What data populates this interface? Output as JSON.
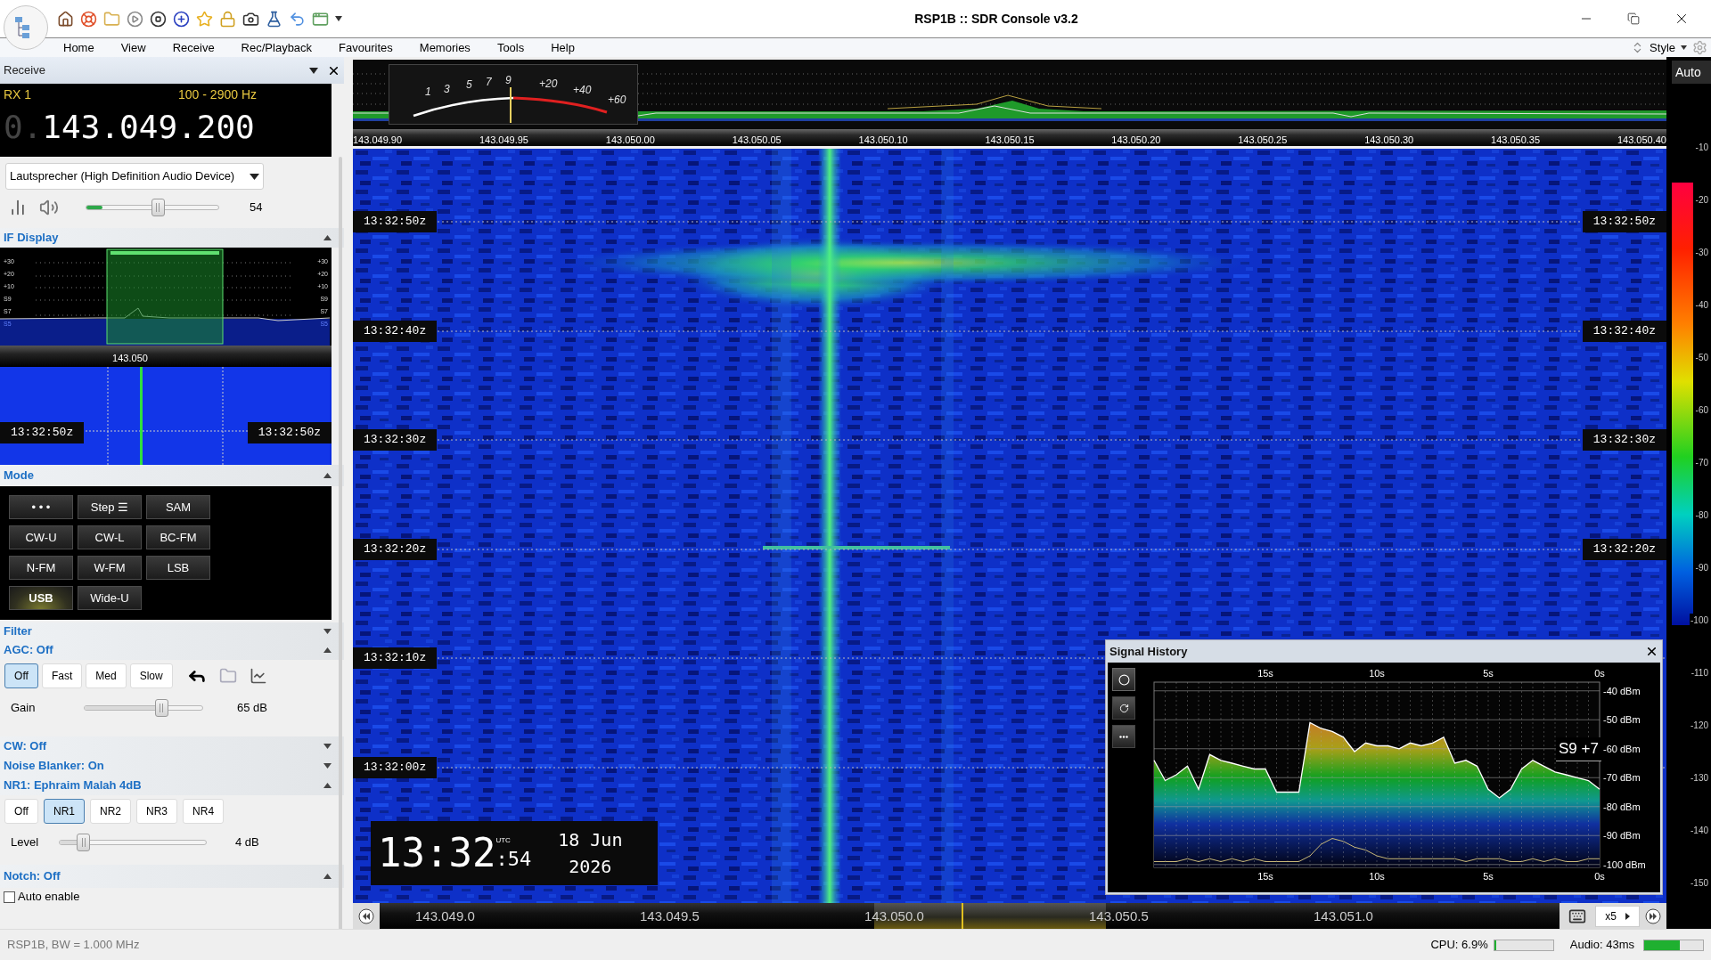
{
  "window": {
    "title": "RSP1B :: SDR Console v3.2"
  },
  "menu": [
    "Home",
    "View",
    "Receive",
    "Rec/Playback",
    "Favourites",
    "Memories",
    "Tools",
    "Help"
  ],
  "style_menu": "Style",
  "receive_panel": {
    "title": "Receive",
    "rx": "RX 1",
    "bandwidth": "100 - 2900 Hz",
    "frequency_prefix": "0.",
    "frequency": "143.049.200",
    "audio_device": "Lautsprecher (High Definition Audio Device)",
    "volume": {
      "level": 0.54,
      "reading": "54"
    },
    "audio_meter": {
      "level": 0.12
    }
  },
  "if_display": {
    "title": "IF Display",
    "expanded": true,
    "scale_left": [
      "+30",
      "+20",
      "+10",
      "S9",
      "S7",
      "S5"
    ],
    "scale_right": [
      "+30",
      "+20",
      "+10",
      "S9",
      "S7",
      "S5"
    ],
    "frequency": "143.050",
    "time_left": "13:32:50z",
    "time_right": "13:32:50z"
  },
  "mode": {
    "title": "Mode",
    "expanded": true,
    "buttons": [
      {
        "label": "• • •",
        "selected": false
      },
      {
        "label": "Step ☰",
        "selected": false
      },
      {
        "label": "SAM",
        "selected": false
      },
      {
        "label": "CW-U",
        "selected": false
      },
      {
        "label": "CW-L",
        "selected": false
      },
      {
        "label": "BC-FM",
        "selected": false
      },
      {
        "label": "N-FM",
        "selected": false
      },
      {
        "label": "W-FM",
        "selected": false
      },
      {
        "label": "LSB",
        "selected": false
      },
      {
        "label": "USB",
        "selected": true
      },
      {
        "label": "Wide-U",
        "selected": false
      }
    ]
  },
  "filter": {
    "title": "Filter",
    "expanded": false
  },
  "agc": {
    "title": "AGC: Off",
    "expanded": true,
    "buttons": [
      {
        "label": "Off",
        "selected": true
      },
      {
        "label": "Fast",
        "selected": false
      },
      {
        "label": "Med",
        "selected": false
      },
      {
        "label": "Slow",
        "selected": false
      }
    ],
    "gain": {
      "label": "Gain",
      "level": 0.65,
      "reading": "65 dB"
    }
  },
  "cw": {
    "title": "CW: Off",
    "expanded": false
  },
  "noise_blanker": {
    "title": "Noise Blanker: On",
    "expanded": false
  },
  "nr": {
    "title": "NR1: Ephraim Malah 4dB",
    "expanded": true,
    "buttons": [
      {
        "label": "Off",
        "selected": false
      },
      {
        "label": "NR1",
        "selected": true
      },
      {
        "label": "NR2",
        "selected": false
      },
      {
        "label": "NR3",
        "selected": false
      },
      {
        "label": "NR4",
        "selected": false
      }
    ],
    "level": {
      "label": "Level",
      "level": 0.16,
      "reading": "4 dB"
    }
  },
  "notch": {
    "title": "Notch: Off",
    "expanded": true,
    "auto_enable": {
      "label": "Auto enable",
      "checked": false
    }
  },
  "spectrum": {
    "smeter_labels": [
      "1",
      "3",
      "5",
      "7",
      "9",
      "+20",
      "+40",
      "+60"
    ],
    "frequency_labels": [
      "143.049.90",
      "143.049.95",
      "143.050.00",
      "143.050.05",
      "143.050.10",
      "143.050.15",
      "143.050.20",
      "143.050.25",
      "143.050.30",
      "143.050.35",
      "143.050.40"
    ]
  },
  "waterfall": {
    "times_left": [
      "13:32:50z",
      "13:32:40z",
      "13:32:30z",
      "13:32:20z",
      "13:32:10z",
      "13:32:00z"
    ],
    "times_right": [
      "13:32:50z",
      "13:32:40z",
      "13:32:30z",
      "13:32:20z"
    ]
  },
  "clock": {
    "time": "13:32",
    "seconds": ":54",
    "zone": "UTC",
    "date": "18 Jun",
    "year": "2026"
  },
  "signal_history": {
    "title": "Signal History",
    "reading": "S9 +7",
    "chart_data": {
      "type": "line",
      "grid": true,
      "xlim": [
        20,
        0
      ],
      "ylim": [
        -101,
        -37
      ],
      "xticks": [
        {
          "value": 15,
          "label": "15s"
        },
        {
          "value": 10,
          "label": "10s"
        },
        {
          "value": 5,
          "label": "5s"
        },
        {
          "value": 0,
          "label": "0s"
        }
      ],
      "yticks": [
        {
          "value": -40,
          "label": "-40 dBm"
        },
        {
          "value": -50,
          "label": "-50 dBm"
        },
        {
          "value": -60,
          "label": "-60 dBm"
        },
        {
          "value": -70,
          "label": "-70 dBm"
        },
        {
          "value": -80,
          "label": "-80 dBm"
        },
        {
          "value": -90,
          "label": "-90 dBm"
        },
        {
          "value": -100,
          "label": "-100 dBm"
        }
      ],
      "x": [
        20,
        19.5,
        19,
        18.5,
        18,
        17.5,
        17,
        16.5,
        16,
        15.5,
        15,
        14.5,
        14,
        13.5,
        13,
        12.5,
        12,
        11.5,
        11,
        10.5,
        10,
        9.5,
        9,
        8.5,
        8,
        7.5,
        7,
        6.5,
        6,
        5.5,
        5,
        4.5,
        4,
        3.5,
        3,
        2.5,
        2,
        1.5,
        1,
        0.5,
        0
      ],
      "series": [
        {
          "color": "#ffffff",
          "values": [
            -64,
            -71,
            -69,
            -66,
            -74,
            -62,
            -64,
            -65,
            -66,
            -67,
            -67,
            -75,
            -75,
            -75,
            -51,
            -53,
            -54,
            -56,
            -61,
            -58,
            -59,
            -59,
            -60,
            -58,
            -59,
            -58,
            -56,
            -65,
            -64,
            -66,
            -74,
            -77,
            -74,
            -67,
            -64,
            -66,
            -68,
            -69,
            -70,
            -71,
            -74
          ]
        },
        {
          "color": "#c8b878",
          "values": [
            -99,
            -99,
            -99,
            -98,
            -99,
            -98,
            -99,
            -98,
            -99,
            -98,
            -99,
            -99,
            -99,
            -99,
            -97,
            -93,
            -91,
            -92,
            -94,
            -95,
            -97,
            -98,
            -98,
            -98,
            -98,
            -98,
            -98,
            -98,
            -99,
            -98,
            -98,
            -98,
            -99,
            -99,
            -98,
            -99,
            -98,
            -99,
            -99,
            -98,
            -98
          ]
        }
      ]
    }
  },
  "level_scale": {
    "mode": "Auto",
    "labels": [
      "-10",
      "-20",
      "-30",
      "-40",
      "-50",
      "-60",
      "-70",
      "-80",
      "-90",
      "-100",
      "-110",
      "-120",
      "-130",
      "-140",
      "-150"
    ]
  },
  "tuning_bar": {
    "labels": [
      "143.049.0",
      "143.049.5",
      "143.050.0",
      "143.050.5",
      "143.051.0"
    ],
    "zoom": "x5"
  },
  "status_bar": {
    "bandwidth": "RSP1B, BW = 1.000 MHz",
    "cpu": {
      "label": "CPU: 6.9%",
      "level": 0.03
    },
    "audio": {
      "label": "Audio: 43ms",
      "level": 0.6
    }
  }
}
